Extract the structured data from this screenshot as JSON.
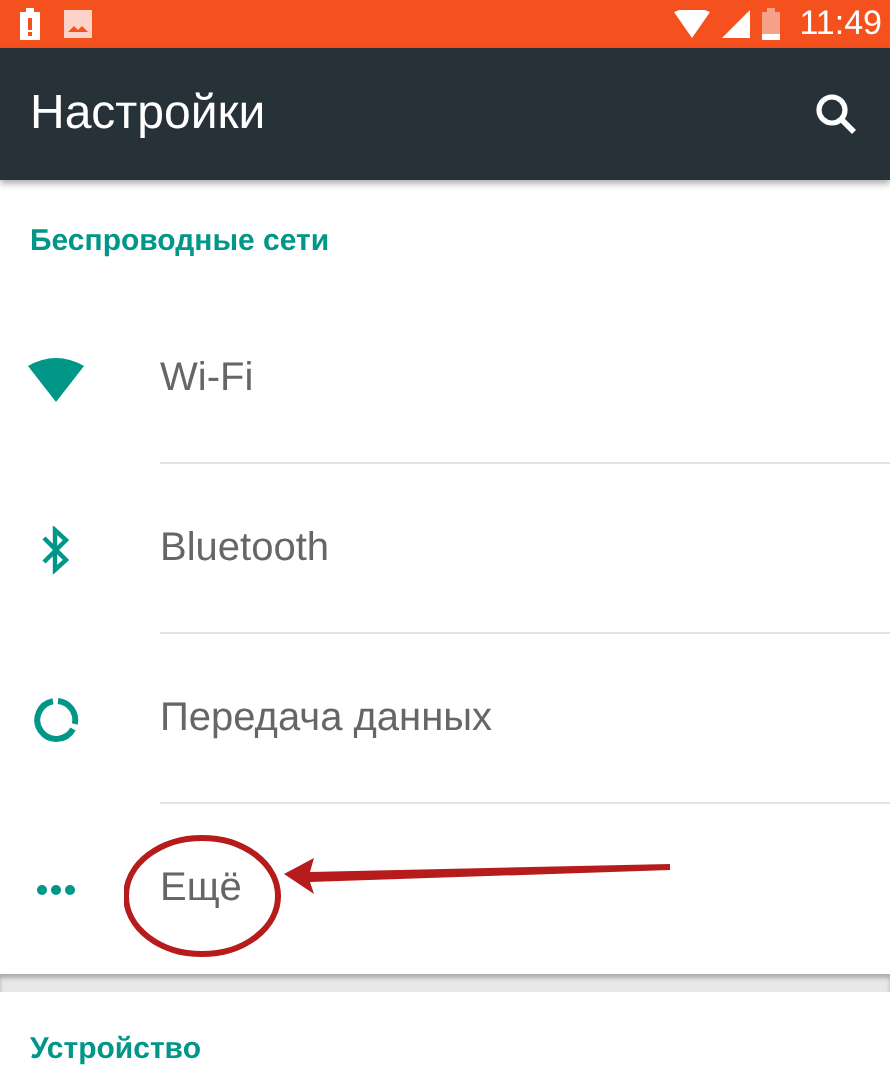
{
  "status_bar": {
    "time": "11:49"
  },
  "app_bar": {
    "title": "Настройки"
  },
  "sections": [
    {
      "title": "Беспроводные сети",
      "items": [
        {
          "kind": "wifi",
          "label": "Wi-Fi"
        },
        {
          "kind": "bluetooth",
          "label": "Bluetooth"
        },
        {
          "kind": "data",
          "label": "Передача данных"
        },
        {
          "kind": "more",
          "label": "Ещё"
        }
      ]
    },
    {
      "title": "Устройство"
    }
  ]
}
